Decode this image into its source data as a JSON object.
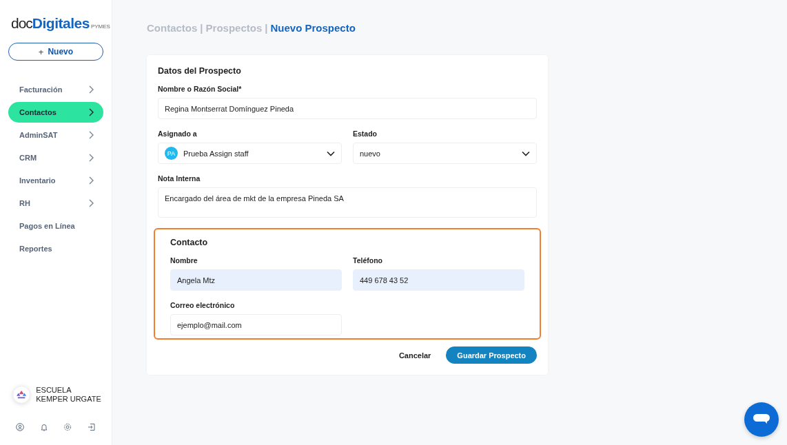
{
  "logo": {
    "part_1": "doc",
    "part_2": "Digitales",
    "part_3": "PYMES"
  },
  "new_button": {
    "icon": "+",
    "label": "Nuevo"
  },
  "nav": [
    {
      "label": "Facturación",
      "kind": "submenu",
      "selected": false
    },
    {
      "label": "Contactos",
      "kind": "submenu",
      "selected": true
    },
    {
      "label": "AdminSAT",
      "kind": "submenu",
      "selected": false
    },
    {
      "label": "CRM",
      "kind": "submenu",
      "selected": false
    },
    {
      "label": "Inventario",
      "kind": "submenu",
      "selected": false
    },
    {
      "label": "RH",
      "kind": "submenu",
      "selected": false
    },
    {
      "label": "Pagos en Línea",
      "kind": "link",
      "selected": false
    },
    {
      "label": "Reportes",
      "kind": "link",
      "selected": false
    }
  ],
  "account": {
    "name": "ESCUELA KEMPER URGATE"
  },
  "breadcrumb": [
    {
      "label": "Contactos",
      "selected": false
    },
    {
      "label": "Prospectos",
      "selected": false
    },
    {
      "label": "Nuevo Prospecto",
      "selected": true
    }
  ],
  "breadcrumb_separator": "|",
  "form": {
    "title": "Datos del Prospecto",
    "name_field": {
      "label": "Nombre o Razón Social*",
      "value": "Regina Montserrat Domínguez Pineda"
    },
    "assigned_field": {
      "label": "Asignado a",
      "initials": "PA",
      "value": "Prueba Assign staff"
    },
    "status_field": {
      "label": "Estado",
      "value": "nuevo"
    },
    "note_field": {
      "label": "Nota Interna",
      "value": "Encargado del área de mkt de la empresa Pineda SA"
    },
    "contact": {
      "title": "Contacto",
      "highlighted": true,
      "fields": [
        {
          "label": "Nombre",
          "value": "Angela Mtz",
          "autofilled": true
        },
        {
          "label": "Teléfono",
          "value": "449 678 43 52",
          "autofilled": true
        },
        {
          "label": "Correo electrónico",
          "value": "ejemplo@mail.com",
          "autofilled": false
        }
      ]
    },
    "cancel_button": "Cancelar",
    "save_button": "Guardar Prospecto"
  }
}
